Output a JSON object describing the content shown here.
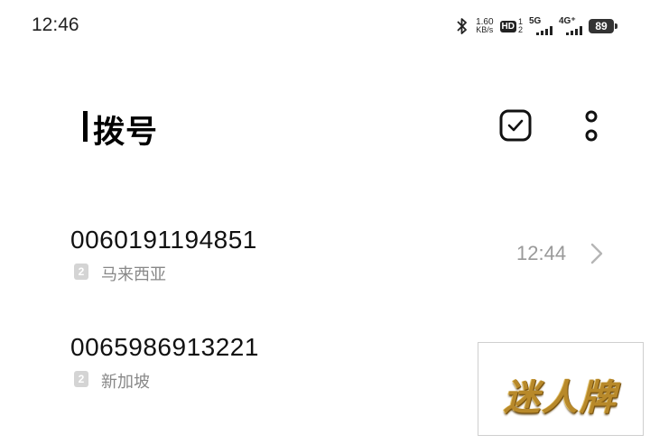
{
  "status_bar": {
    "time": "12:46",
    "speed_value": "1.60",
    "speed_unit": "KB/s",
    "hd_label": "HD",
    "hd_sim1": "1",
    "hd_sim2": "2",
    "net1_label": "5G",
    "net2_label": "4G⁺",
    "battery": "89"
  },
  "header": {
    "title": "拨号",
    "select_icon": "checkbox-select-icon",
    "more_icon": "more-vertical-icon"
  },
  "calls": [
    {
      "number": "0060191194851",
      "sim": "2",
      "location": "马来西亚",
      "time": "12:44"
    },
    {
      "number": "0065986913221",
      "sim": "2",
      "location": "新加坡",
      "time": ""
    }
  ],
  "logo": {
    "text": "迷人牌"
  },
  "colors": {
    "secondary_text": "#888888",
    "time_text": "#999999",
    "logo_gold": "#b8892a"
  }
}
